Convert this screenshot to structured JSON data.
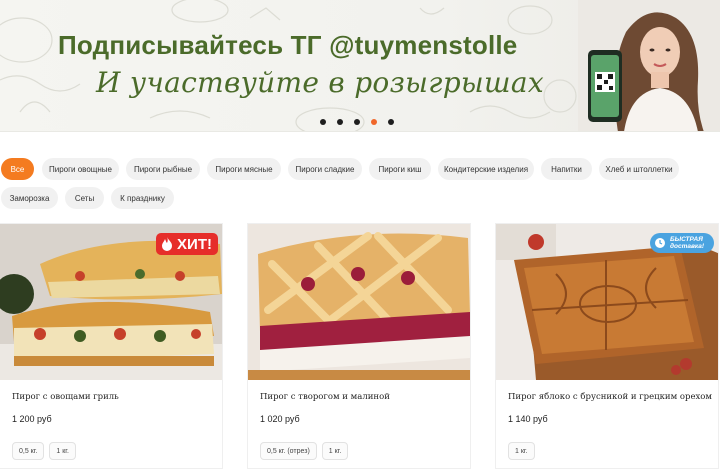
{
  "banner": {
    "title": "Подписывайтесь ТГ @tuymenstolle",
    "subtitle": "И участвуйте в розыгрышах",
    "slides_total": 5,
    "active_slide": 4
  },
  "categories": [
    {
      "label": "Все",
      "active": true
    },
    {
      "label": "Пироги овощные",
      "active": false
    },
    {
      "label": "Пироги рыбные",
      "active": false
    },
    {
      "label": "Пироги мясные",
      "active": false
    },
    {
      "label": "Пироги сладкие",
      "active": false
    },
    {
      "label": "Пироги киш",
      "active": false
    },
    {
      "label": "Кондитерские изделия",
      "active": false
    },
    {
      "label": "Напитки",
      "active": false
    },
    {
      "label": "Хлеб и штоллетки",
      "active": false
    },
    {
      "label": "Заморозка",
      "active": false
    },
    {
      "label": "Сеты",
      "active": false
    },
    {
      "label": "К празднику",
      "active": false
    }
  ],
  "products": [
    {
      "name": "Пирог с овощами гриль",
      "price": "1 200 руб",
      "weights": [
        "0,5 кг.",
        "1 кг."
      ],
      "badge": "ХИТ!"
    },
    {
      "name": "Пирог с творогом и малиной",
      "price": "1 020 руб",
      "weights": [
        "0,5 кг. (отрез)",
        "1 кг."
      ],
      "badge": ""
    },
    {
      "name": "Пирог яблоко с брусникой и грецким орехом",
      "price": "1 140 руб",
      "weights": [
        "1 кг."
      ],
      "badge": "БЫСТРАЯ доставка!"
    }
  ],
  "badges": {
    "hit": "ХИТ!",
    "fast_line1": "БЫСТРАЯ",
    "fast_line2": "доставка!"
  },
  "colors": {
    "accent": "#f47b20",
    "banner_text": "#4b6b2a",
    "hit_badge": "#e62e2a",
    "fast_badge": "#4aa3e0"
  }
}
